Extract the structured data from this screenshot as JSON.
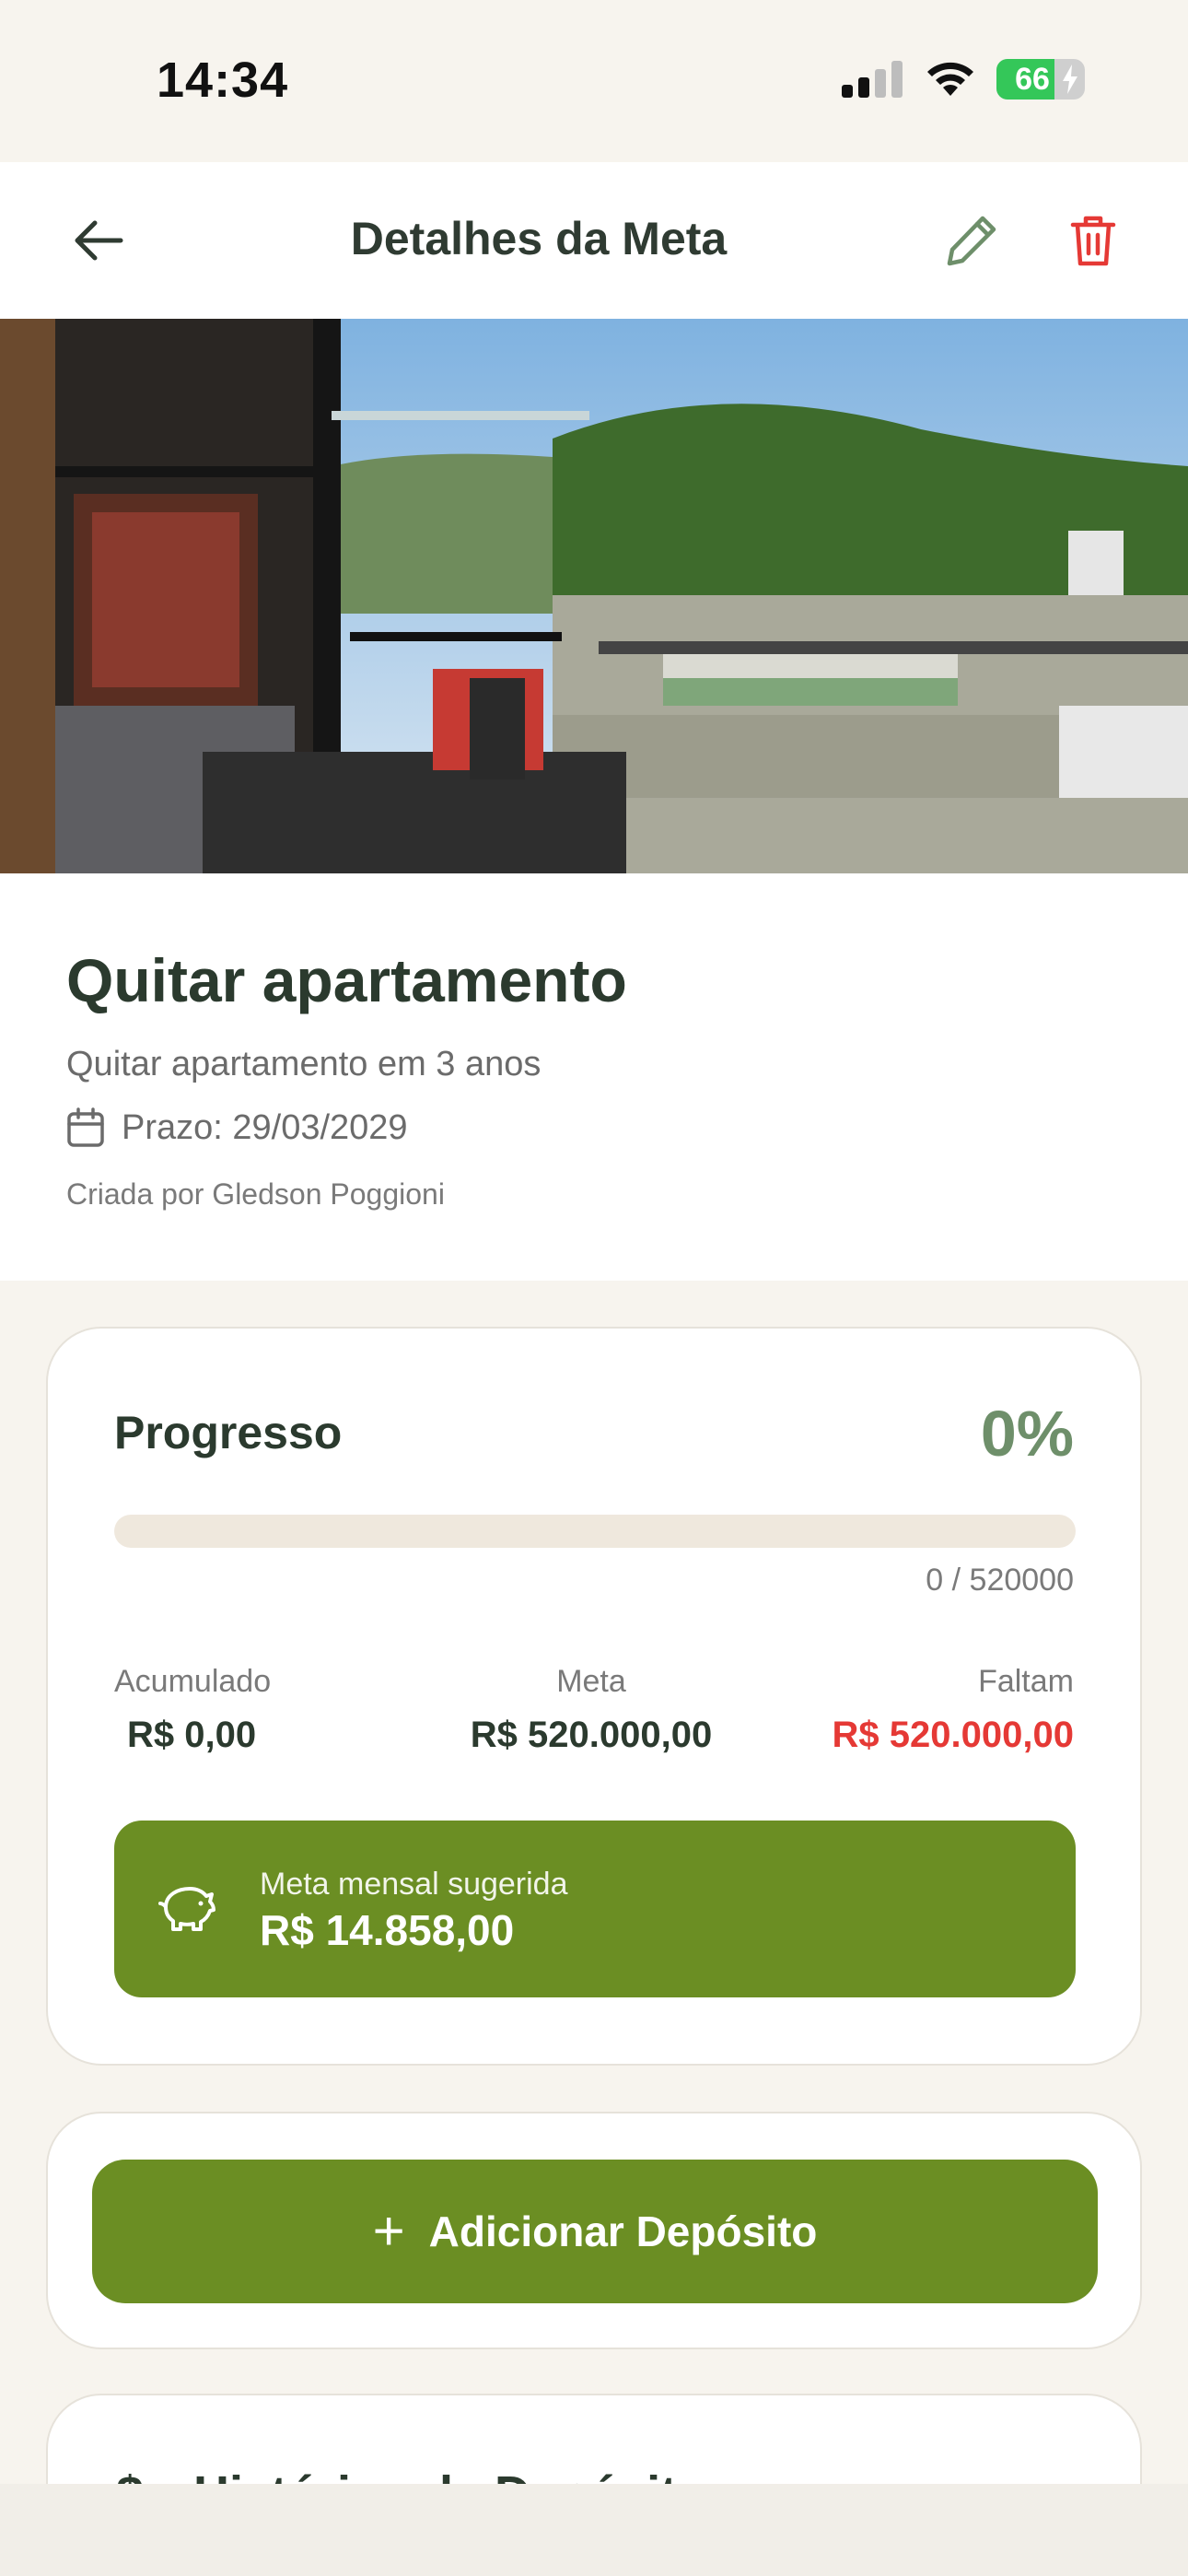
{
  "status_bar": {
    "time": "14:34",
    "battery": "66",
    "battery_level": 0.66
  },
  "header": {
    "title": "Detalhes da Meta",
    "back_icon": "arrow-left-icon",
    "edit_icon": "pencil-icon",
    "delete_icon": "trash-icon"
  },
  "goal": {
    "title": "Quitar apartamento",
    "description": "Quitar apartamento em 3 anos",
    "deadline": "Prazo: 29/03/2029",
    "creator": "Criada por Gledson Poggioni"
  },
  "progress": {
    "label": "Progresso",
    "percent": "0%",
    "fraction": 0,
    "count": "0 / 520000",
    "accumulated_label": "Acumulado",
    "accumulated_value": "R$ 0,00",
    "target_label": "Meta",
    "target_value": "R$ 520.000,00",
    "remaining_label": "Faltam",
    "remaining_value": "R$ 520.000,00",
    "suggested_label": "Meta mensal sugerida",
    "suggested_value": "R$ 14.858,00"
  },
  "actions": {
    "add_deposit_label": "Adicionar Depósito"
  },
  "history": {
    "title": "Histórico de Depósitos"
  },
  "colors": {
    "accent": "#6B8E23",
    "danger": "#E53935",
    "percent": "#6E8F6A",
    "background": "#F7F4EE"
  }
}
